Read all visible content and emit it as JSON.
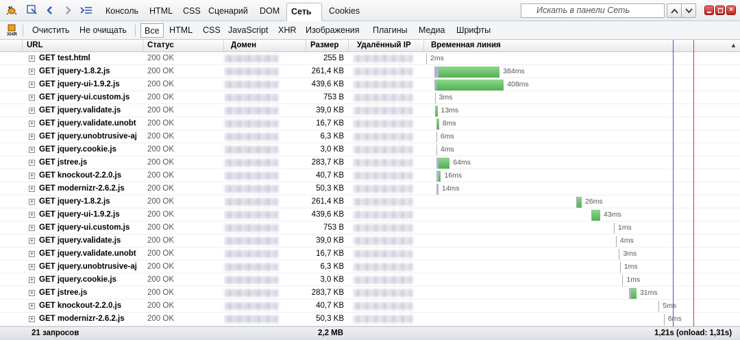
{
  "toolbar": {
    "tabs": [
      {
        "label": "Консоль"
      },
      {
        "label": "HTML"
      },
      {
        "label": "CSS"
      },
      {
        "label": "Сценарий"
      },
      {
        "label": "DOM"
      },
      {
        "label": "Сеть"
      },
      {
        "label": "Cookies"
      }
    ],
    "active_tab": "Сеть",
    "search_placeholder": "Искать в панели Сеть"
  },
  "filterbar": {
    "clear_label": "Очистить",
    "persist_label": "Не очищать",
    "filters": [
      "Все",
      "HTML",
      "CSS",
      "JavaScript",
      "XHR",
      "Изображения",
      "Плагины",
      "Медиа",
      "Шрифты"
    ],
    "active_filter": "Все"
  },
  "columns": {
    "url": "URL",
    "status": "Статус",
    "domain": "Домен",
    "size": "Размер",
    "ip": "Удалённый IP",
    "timeline": "Временная линия"
  },
  "requests": [
    {
      "url": "GET test.html",
      "status": "200 OK",
      "size": "255 B",
      "time": "2ms",
      "start": 0.0,
      "wait": 0.0,
      "recv": 0.0
    },
    {
      "url": "GET jquery-1.8.2.js",
      "status": "200 OK",
      "size": "261,4 KB",
      "time": "384ms",
      "start": 0.04,
      "wait": 0.02,
      "recv": 0.3
    },
    {
      "url": "GET jquery-ui-1.9.2.js",
      "status": "200 OK",
      "size": "439,6 KB",
      "time": "408ms",
      "start": 0.04,
      "wait": 0.003,
      "recv": 0.33
    },
    {
      "url": "GET jquery-ui.custom.js",
      "status": "200 OK",
      "size": "753 B",
      "time": "3ms",
      "start": 0.042,
      "wait": 0.0,
      "recv": 0.0
    },
    {
      "url": "GET jquery.validate.js",
      "status": "200 OK",
      "size": "39,0 KB",
      "time": "13ms",
      "start": 0.042,
      "wait": 0.0,
      "recv": 0.01
    },
    {
      "url": "GET jquery.validate.unobtrusive.js",
      "status": "200 OK",
      "size": "16,7 KB",
      "time": "8ms",
      "start": 0.05,
      "wait": 0.0,
      "recv": 0.008
    },
    {
      "url": "GET jquery.unobtrusive-ajax.js",
      "status": "200 OK",
      "size": "6,3 KB",
      "time": "6ms",
      "start": 0.05,
      "wait": 0.0,
      "recv": 0.0
    },
    {
      "url": "GET jquery.cookie.js",
      "status": "200 OK",
      "size": "3,0 KB",
      "time": "4ms",
      "start": 0.05,
      "wait": 0.0,
      "recv": 0.0
    },
    {
      "url": "GET jstree.js",
      "status": "200 OK",
      "size": "283,7 KB",
      "time": "64ms",
      "start": 0.05,
      "wait": 0.005,
      "recv": 0.055
    },
    {
      "url": "GET knockout-2.2.0.js",
      "status": "200 OK",
      "size": "40,7 KB",
      "time": "16ms",
      "start": 0.05,
      "wait": 0.003,
      "recv": 0.012
    },
    {
      "url": "GET modernizr-2.6.2.js",
      "status": "200 OK",
      "size": "50,3 KB",
      "time": "14ms",
      "start": 0.05,
      "wait": 0.008,
      "recv": 0.0
    },
    {
      "url": "GET jquery-1.8.2.js",
      "status": "200 OK",
      "size": "261,4 KB",
      "time": "26ms",
      "start": 0.735,
      "wait": 0.0,
      "recv": 0.024
    },
    {
      "url": "GET jquery-ui-1.9.2.js",
      "status": "200 OK",
      "size": "439,6 KB",
      "time": "43ms",
      "start": 0.81,
      "wait": 0.0,
      "recv": 0.04
    },
    {
      "url": "GET jquery-ui.custom.js",
      "status": "200 OK",
      "size": "753 B",
      "time": "1ms",
      "start": 0.92,
      "wait": 0.0,
      "recv": 0.0
    },
    {
      "url": "GET jquery.validate.js",
      "status": "200 OK",
      "size": "39,0 KB",
      "time": "4ms",
      "start": 0.93,
      "wait": 0.0,
      "recv": 0.0
    },
    {
      "url": "GET jquery.validate.unobtrusive.js",
      "status": "200 OK",
      "size": "16,7 KB",
      "time": "3ms",
      "start": 0.945,
      "wait": 0.0,
      "recv": 0.0
    },
    {
      "url": "GET jquery.unobtrusive-ajax.js",
      "status": "200 OK",
      "size": "6,3 KB",
      "time": "1ms",
      "start": 0.95,
      "wait": 0.0,
      "recv": 0.0
    },
    {
      "url": "GET jquery.cookie.js",
      "status": "200 OK",
      "size": "3,0 KB",
      "time": "1ms",
      "start": 0.962,
      "wait": 0.0,
      "recv": 0.0
    },
    {
      "url": "GET jstree.js",
      "status": "200 OK",
      "size": "283,7 KB",
      "time": "31ms",
      "start": 0.995,
      "wait": 0.006,
      "recv": 0.026
    },
    {
      "url": "GET knockout-2.2.0.js",
      "status": "200 OK",
      "size": "40,7 KB",
      "time": "5ms",
      "start": 1.14,
      "wait": 0.0,
      "recv": 0.0
    },
    {
      "url": "GET modernizr-2.6.2.js",
      "status": "200 OK",
      "size": "50,3 KB",
      "time": "6ms",
      "start": 1.165,
      "wait": 0.0,
      "recv": 0.0
    }
  ],
  "timeline": {
    "total_s": 1.31,
    "domcontent_s": 1.21,
    "onload_s": 1.31
  },
  "footer": {
    "count": "21 запросов",
    "total_size": "2,2 MB",
    "total_time": "1,21s (onload: 1,31s)"
  },
  "colors": {
    "wait": "#b6b2d2",
    "receive": "#5bbd5b",
    "domcontent_line": "#4a4ae0",
    "onload_line": "#d33"
  }
}
